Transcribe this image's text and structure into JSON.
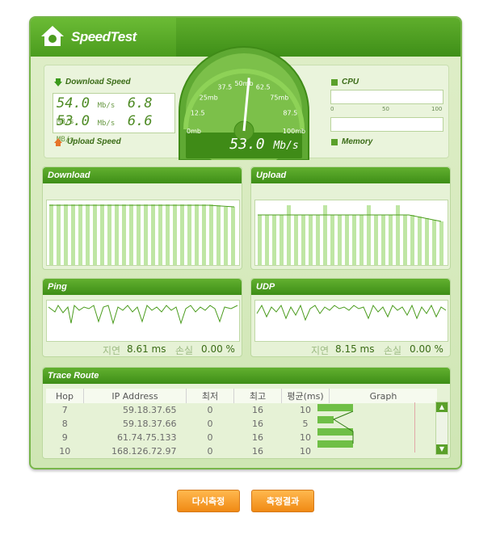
{
  "app": {
    "title": "SpeedTest"
  },
  "speed": {
    "download_label": "Download Speed",
    "upload_label": "Upload Speed",
    "download_mbps": "54.0",
    "download_mbps_unit": "Mb/s",
    "download_MBps": "6.8",
    "download_MBps_unit": "MB/s",
    "upload_mbps": "53.0",
    "upload_mbps_unit": "Mb/s",
    "upload_MBps": "6.6",
    "upload_MBps_unit": "MB/s"
  },
  "gauge": {
    "value": "53.0",
    "unit": "Mb/s",
    "ticks": [
      "0mb",
      "12.5",
      "25mb",
      "37.5",
      "50mb",
      "62.5",
      "75mb",
      "87.5",
      "100mb"
    ],
    "needle_value": 53
  },
  "system": {
    "cpu_label": "CPU",
    "memory_label": "Memory",
    "scale": [
      "0",
      "50",
      "100"
    ],
    "cpu_level": 0,
    "memory_level": 0
  },
  "panels": {
    "download": {
      "title": "Download"
    },
    "upload": {
      "title": "Upload"
    },
    "ping": {
      "title": "Ping",
      "delay_label": "지연",
      "delay_value": "8.61 ms",
      "loss_label": "손실",
      "loss_value": "0.00 %"
    },
    "udp": {
      "title": "UDP",
      "delay_label": "지연",
      "delay_value": "8.15 ms",
      "loss_label": "손실",
      "loss_value": "0.00 %"
    }
  },
  "trace": {
    "title": "Trace Route",
    "columns": [
      "Hop",
      "IP Address",
      "최저",
      "최고",
      "평균(ms)",
      "Graph"
    ],
    "rows": [
      {
        "hop": "7",
        "ip": "59.18.37.65",
        "min": "0",
        "max": "16",
        "avg": "10"
      },
      {
        "hop": "8",
        "ip": "59.18.37.66",
        "min": "0",
        "max": "16",
        "avg": "5"
      },
      {
        "hop": "9",
        "ip": "61.74.75.133",
        "min": "0",
        "max": "16",
        "avg": "10"
      },
      {
        "hop": "10",
        "ip": "168.126.72.97",
        "min": "0",
        "max": "16",
        "avg": "10"
      }
    ]
  },
  "buttons": {
    "retest": "다시측정",
    "results": "측정결과"
  },
  "colors": {
    "brand_green": "#4b9c1e",
    "button_orange": "#f08a14"
  }
}
